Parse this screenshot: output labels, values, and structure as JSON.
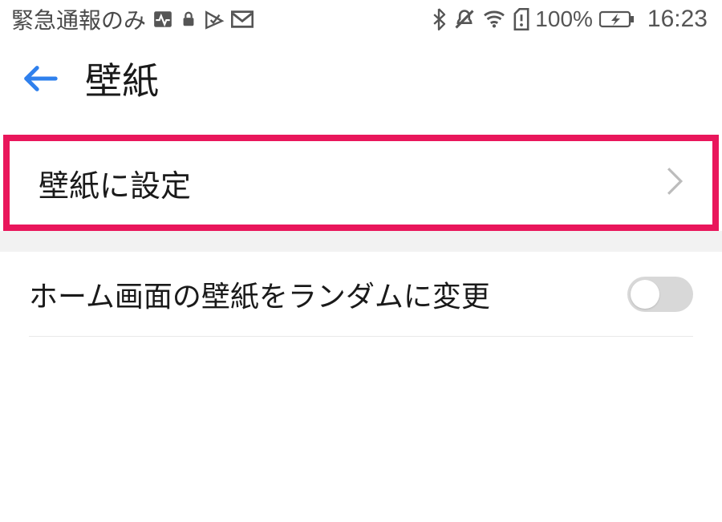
{
  "statusbar": {
    "network_text": "緊急通報のみ",
    "battery_text": "100%",
    "time": "16:23"
  },
  "header": {
    "title": "壁紙"
  },
  "rows": {
    "set_wallpaper_label": "壁紙に設定",
    "random_home_label": "ホーム画面の壁紙をランダムに変更"
  }
}
